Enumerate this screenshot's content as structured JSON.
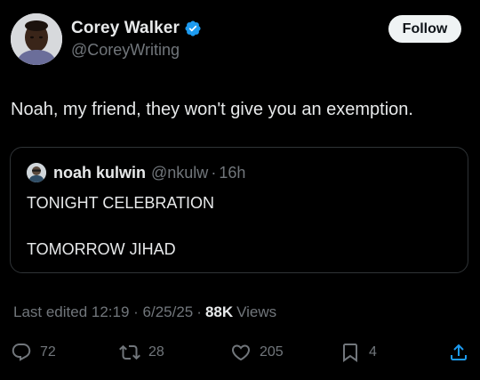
{
  "author": {
    "name": "Corey Walker",
    "handle": "@CoreyWriting",
    "verified": true,
    "verified_color": "#1d9bf0"
  },
  "follow_button": {
    "label": "Follow"
  },
  "tweet": {
    "text": "Noah, my friend, they won't give you an exemption."
  },
  "quoted_tweet": {
    "name": "noah kulwin",
    "handle": "@nkulw",
    "separator": "·",
    "time": "16h",
    "lines": [
      "TONIGHT CELEBRATION",
      "TOMORROW JIHAD"
    ]
  },
  "meta": {
    "edited": "Last edited 12:19 · 6/25/25",
    "separator": "·",
    "views_count": "88K",
    "views_label": "Views"
  },
  "actions": {
    "replies": "72",
    "reposts": "28",
    "likes": "205",
    "bookmarks": "4"
  },
  "colors": {
    "background": "#000000",
    "primary_text": "#e7e9ea",
    "secondary_text": "#71767b",
    "border": "#2f3336",
    "follow_bg": "#eff3f4"
  },
  "icons": {
    "reply": "speech-bubble-icon",
    "repost": "repost-arrows-icon",
    "like": "heart-icon",
    "bookmark": "bookmark-icon",
    "share": "share-upload-icon",
    "verified": "verified-badge-icon"
  }
}
